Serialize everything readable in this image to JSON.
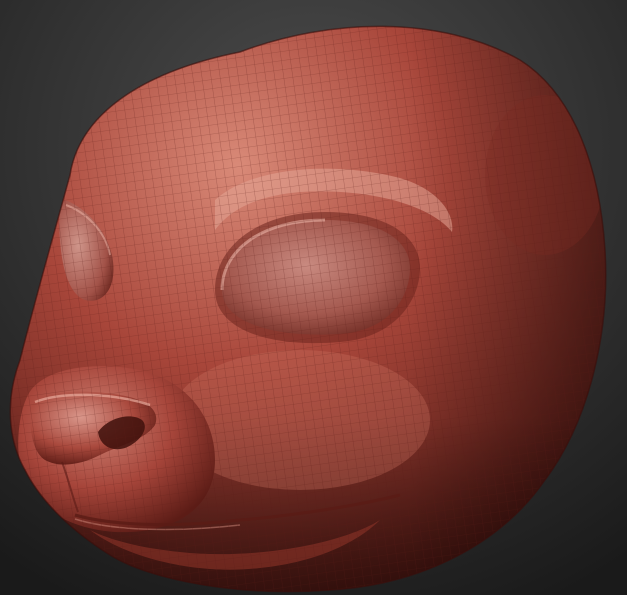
{
  "viewport": {
    "background_top": "#4d4d4d",
    "background_bottom": "#1a1a1a"
  },
  "model": {
    "subject": "sculpted-animal-head",
    "material_color": "#a8463a",
    "material_highlight": "#e0a090",
    "material_shadow": "#4e1712",
    "wireframe_visible": true,
    "wireframe_color": "#5a1c15"
  }
}
